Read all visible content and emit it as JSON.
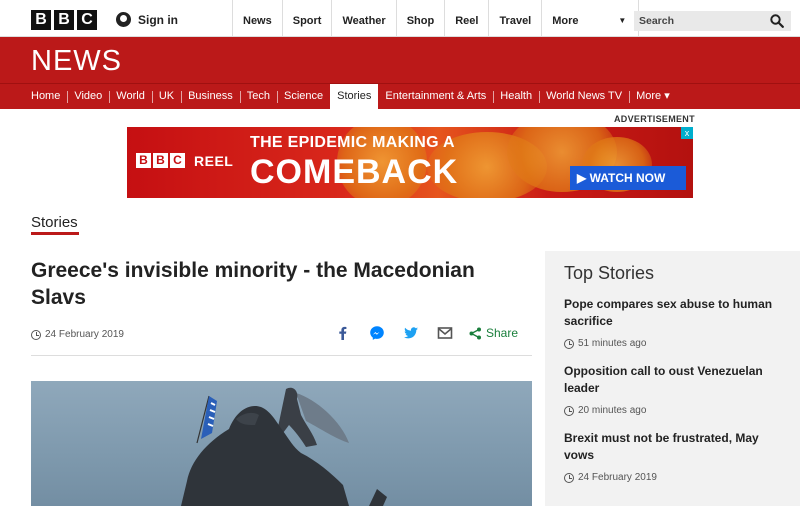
{
  "masthead": {
    "logo_letters": [
      "B",
      "B",
      "C"
    ],
    "sign_in": "Sign in",
    "nav": [
      "News",
      "Sport",
      "Weather",
      "Shop",
      "Reel",
      "Travel",
      "More"
    ],
    "search_placeholder": "Search"
  },
  "news_header": {
    "title": "NEWS",
    "nav": [
      {
        "label": "Home",
        "active": false
      },
      {
        "label": "Video",
        "active": false
      },
      {
        "label": "World",
        "active": false
      },
      {
        "label": "UK",
        "active": false
      },
      {
        "label": "Business",
        "active": false
      },
      {
        "label": "Tech",
        "active": false
      },
      {
        "label": "Science",
        "active": false
      },
      {
        "label": "Stories",
        "active": true
      },
      {
        "label": "Entertainment & Arts",
        "active": false
      },
      {
        "label": "Health",
        "active": false
      },
      {
        "label": "World News TV",
        "active": false
      },
      {
        "label": "More ▾",
        "active": false
      }
    ]
  },
  "ad": {
    "label": "ADVERTISEMENT",
    "brand_letters": [
      "B",
      "B",
      "C"
    ],
    "brand_word": "REEL",
    "line1": "THE EPIDEMIC MAKING A",
    "line2": "COMEBACK",
    "cta": "▶ WATCH NOW",
    "close": "x"
  },
  "article": {
    "section": "Stories",
    "headline": "Greece's invisible minority - the Macedonian Slavs",
    "date": "24 February 2019",
    "share_label": "Share"
  },
  "sidebar": {
    "title": "Top Stories",
    "stories": [
      {
        "title": "Pope compares sex abuse to human sacrifice",
        "time": "51 minutes ago"
      },
      {
        "title": "Opposition call to oust Venezuelan leader",
        "time": "20 minutes ago"
      },
      {
        "title": "Brexit must not be frustrated, May vows",
        "time": "24 February 2019"
      }
    ]
  },
  "colors": {
    "brand_red": "#bb1919",
    "share_green": "#1a7f3c",
    "facebook": "#3b5998",
    "messenger": "#0084ff",
    "twitter": "#1da1f2"
  }
}
